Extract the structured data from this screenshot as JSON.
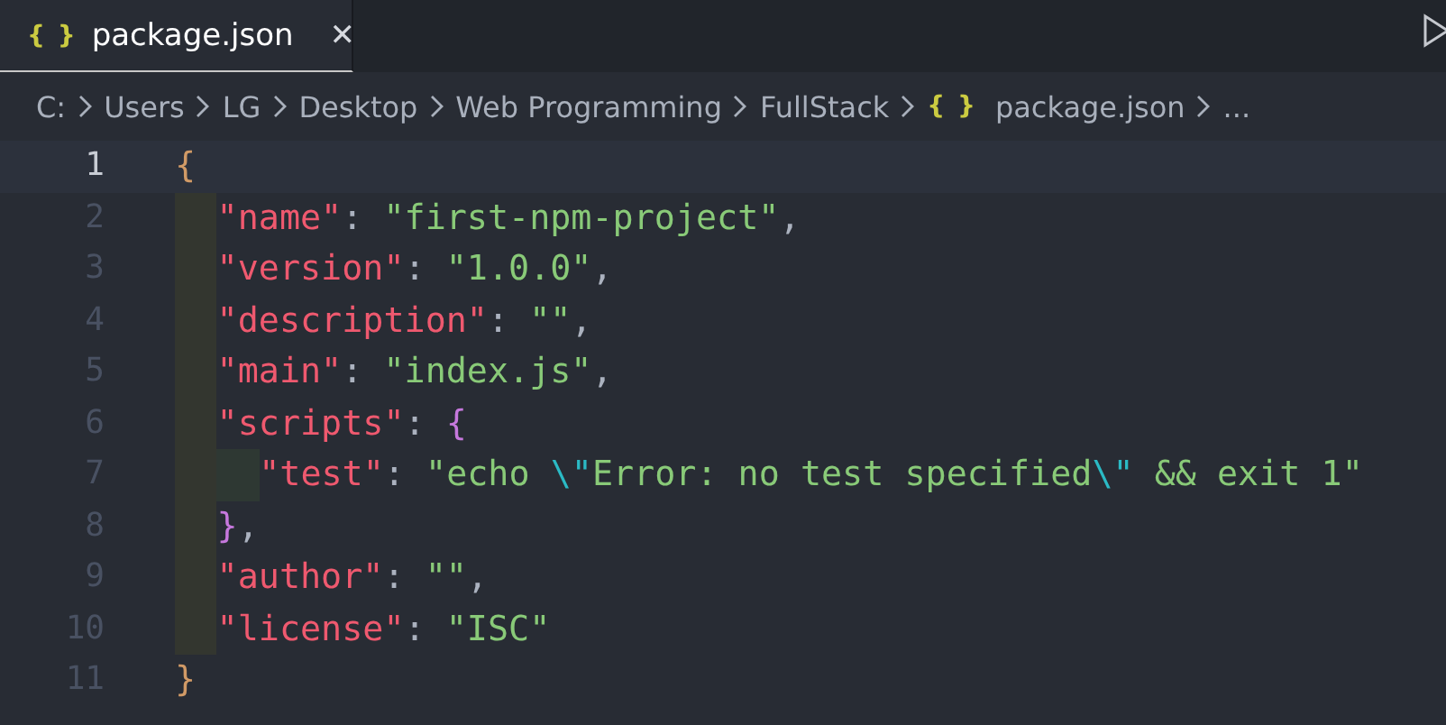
{
  "tabs": [
    {
      "icon": "{ }",
      "label": "package.json",
      "close": "✕",
      "selected": true
    }
  ],
  "breadcrumb": [
    {
      "kind": "folder",
      "label": "C:"
    },
    {
      "kind": "folder",
      "label": "Users"
    },
    {
      "kind": "folder",
      "label": "LG"
    },
    {
      "kind": "folder",
      "label": "Desktop"
    },
    {
      "kind": "folder",
      "label": "Web Programming"
    },
    {
      "kind": "folder",
      "label": "FullStack"
    },
    {
      "kind": "file",
      "icon": "{ }",
      "label": "package.json"
    },
    {
      "kind": "more",
      "label": "..."
    }
  ],
  "editor": {
    "lines": [
      {
        "number": "1",
        "selected": true,
        "tokens": [
          {
            "kind": "brace1",
            "text": "{"
          }
        ],
        "children": [
          {
            "number": "2",
            "selected": false,
            "tokens": [
              {
                "kind": "key",
                "text": "\"name\""
              },
              {
                "kind": "punct",
                "text": ": "
              },
              {
                "kind": "string",
                "text": "\"first-npm-project\""
              },
              {
                "kind": "punct",
                "text": ","
              }
            ]
          },
          {
            "number": "3",
            "selected": false,
            "tokens": [
              {
                "kind": "key",
                "text": "\"version\""
              },
              {
                "kind": "punct",
                "text": ": "
              },
              {
                "kind": "string",
                "text": "\"1.0.0\""
              },
              {
                "kind": "punct",
                "text": ","
              }
            ]
          },
          {
            "number": "4",
            "selected": false,
            "tokens": [
              {
                "kind": "key",
                "text": "\"description\""
              },
              {
                "kind": "punct",
                "text": ": "
              },
              {
                "kind": "string",
                "text": "\"\""
              },
              {
                "kind": "punct",
                "text": ","
              }
            ]
          },
          {
            "number": "5",
            "selected": false,
            "tokens": [
              {
                "kind": "key",
                "text": "\"main\""
              },
              {
                "kind": "punct",
                "text": ": "
              },
              {
                "kind": "string",
                "text": "\"index.js\""
              },
              {
                "kind": "punct",
                "text": ","
              }
            ]
          },
          {
            "number": "6",
            "selected": false,
            "tokens": [
              {
                "kind": "key",
                "text": "\"scripts\""
              },
              {
                "kind": "punct",
                "text": ": "
              },
              {
                "kind": "brace2",
                "text": "{"
              }
            ],
            "children": [
              {
                "number": "7",
                "selected": false,
                "tokens": [
                  {
                    "kind": "key",
                    "text": "\"test\""
                  },
                  {
                    "kind": "punct",
                    "text": ": "
                  },
                  {
                    "kind": "string",
                    "text": "\"echo "
                  },
                  {
                    "kind": "escape",
                    "text": "\\\""
                  },
                  {
                    "kind": "string",
                    "text": "Error: no test specified"
                  },
                  {
                    "kind": "escape",
                    "text": "\\\""
                  },
                  {
                    "kind": "string",
                    "text": " && exit 1\""
                  }
                ]
              }
            ]
          },
          {
            "number": "8",
            "selected": false,
            "tokens": [
              {
                "kind": "brace2",
                "text": "}"
              },
              {
                "kind": "punct",
                "text": ","
              }
            ]
          },
          {
            "number": "9",
            "selected": false,
            "tokens": [
              {
                "kind": "key",
                "text": "\"author\""
              },
              {
                "kind": "punct",
                "text": ": "
              },
              {
                "kind": "string",
                "text": "\"\""
              },
              {
                "kind": "punct",
                "text": ","
              }
            ]
          },
          {
            "number": "10",
            "selected": false,
            "tokens": [
              {
                "kind": "key",
                "text": "\"license\""
              },
              {
                "kind": "punct",
                "text": ": "
              },
              {
                "kind": "string",
                "text": "\"ISC\""
              }
            ]
          }
        ]
      },
      {
        "number": "11",
        "selected": false,
        "tokens": [
          {
            "kind": "brace1",
            "text": "}"
          }
        ]
      }
    ]
  }
}
